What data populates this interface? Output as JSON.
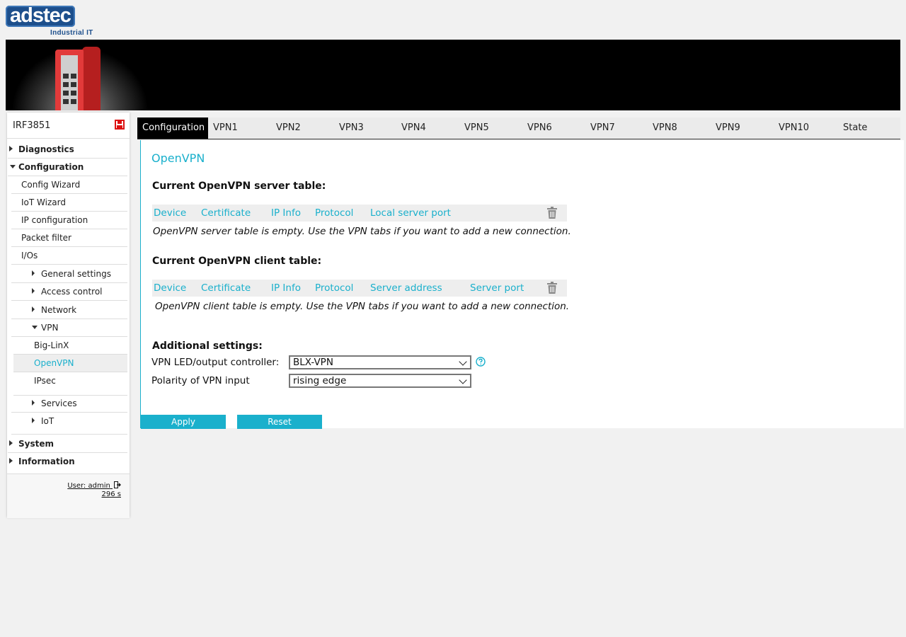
{
  "logo": {
    "brand": "adstec",
    "subtitle": "Industrial IT"
  },
  "sidebar": {
    "device_name": "IRF3851",
    "items": [
      {
        "label": "Diagnostics"
      },
      {
        "label": "Configuration"
      },
      {
        "label": "Config Wizard"
      },
      {
        "label": "IoT Wizard"
      },
      {
        "label": "IP configuration"
      },
      {
        "label": "Packet filter"
      },
      {
        "label": "I/Os"
      },
      {
        "label": "General settings"
      },
      {
        "label": "Access control"
      },
      {
        "label": "Network"
      },
      {
        "label": "VPN"
      },
      {
        "label": "Big-LinX"
      },
      {
        "label": "OpenVPN"
      },
      {
        "label": "IPsec"
      },
      {
        "label": "Services"
      },
      {
        "label": "IoT"
      },
      {
        "label": "System"
      },
      {
        "label": "Information"
      }
    ],
    "user": "User: admin",
    "timer": "296 s"
  },
  "tabs": [
    "Configuration",
    "VPN1",
    "VPN2",
    "VPN3",
    "VPN4",
    "VPN5",
    "VPN6",
    "VPN7",
    "VPN8",
    "VPN9",
    "VPN10",
    "State"
  ],
  "main": {
    "title": "OpenVPN",
    "server_table": {
      "title": "Current OpenVPN server table:",
      "columns": [
        "Device",
        "Certificate",
        "IP Info",
        "Protocol",
        "Local server port"
      ],
      "empty": "OpenVPN server table is empty. Use the VPN tabs if you want to add a new connection."
    },
    "client_table": {
      "title": "Current OpenVPN client table:",
      "columns": [
        "Device",
        "Certificate",
        "IP Info",
        "Protocol",
        "Server address",
        "Server port"
      ],
      "empty": "OpenVPN client table is empty. Use the VPN tabs if you want to add a new connection."
    },
    "additional": {
      "title": "Additional settings:",
      "led_label": "VPN LED/output controller:",
      "led_value": "BLX-VPN",
      "polarity_label": "Polarity of VPN input",
      "polarity_value": "rising edge"
    },
    "apply_label": "Apply",
    "reset_label": "Reset"
  },
  "colors": {
    "accent": "#1ab0cc",
    "brand": "#1d4f8c",
    "banner": "#000000"
  },
  "icons": {
    "save": "save-icon",
    "trash": "trash-icon",
    "help": "help-icon",
    "logout": "logout-icon"
  }
}
